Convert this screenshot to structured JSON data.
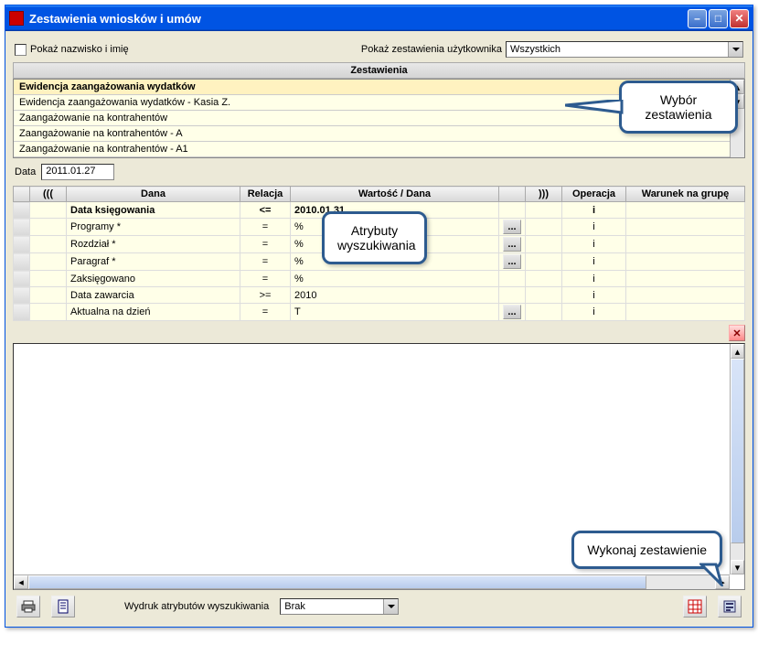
{
  "titlebar": {
    "title": "Zestawienia wniosków i umów"
  },
  "filter": {
    "checkbox_label": "Pokaż nazwisko i imię",
    "dropdown_label": "Pokaż zestawienia użytkownika",
    "dropdown_value": "Wszystkich"
  },
  "list": {
    "header": "Zestawienia",
    "rows": [
      "Ewidencja zaangażowania wydatków",
      "Ewidencja zaangażowania wydatków - Kasia Z.",
      "Zaangażowanie na kontrahentów",
      "Zaangażowanie na kontrahentów - A",
      "Zaangażowanie na kontrahentów - A1"
    ]
  },
  "date": {
    "label": "Data",
    "value": "2011.01.27"
  },
  "attrs": {
    "headers": {
      "open": "(((",
      "dana": "Dana",
      "relacja": "Relacja",
      "wartosc": "Wartość / Dana",
      "close": ")))",
      "operacja": "Operacja",
      "warunek": "Warunek na grupę"
    },
    "rows": [
      {
        "dana": "Data księgowania",
        "relacja": "<=",
        "wartosc": "2010.01.31",
        "btn": false,
        "operacja": "i"
      },
      {
        "dana": "Programy *",
        "relacja": "=",
        "wartosc": "%",
        "btn": true,
        "operacja": "i"
      },
      {
        "dana": "Rozdział *",
        "relacja": "=",
        "wartosc": "%",
        "btn": true,
        "operacja": "i"
      },
      {
        "dana": "Paragraf *",
        "relacja": "=",
        "wartosc": "%",
        "btn": true,
        "operacja": "i"
      },
      {
        "dana": "Zaksięgowano",
        "relacja": "=",
        "wartosc": "%",
        "btn": false,
        "operacja": "i"
      },
      {
        "dana": "Data zawarcia",
        "relacja": ">=",
        "wartosc": "2010",
        "btn": false,
        "operacja": "i"
      },
      {
        "dana": "Aktualna na dzień",
        "relacja": "=",
        "wartosc": "T",
        "btn": true,
        "operacja": "i"
      }
    ]
  },
  "bottom": {
    "label": "Wydruk atrybutów wyszukiwania",
    "dropdown_value": "Brak"
  },
  "callouts": {
    "c1": "Wybór\nzestawienia",
    "c2": "Atrybuty\nwyszukiwania",
    "c3": "Wykonaj zestawienie"
  }
}
